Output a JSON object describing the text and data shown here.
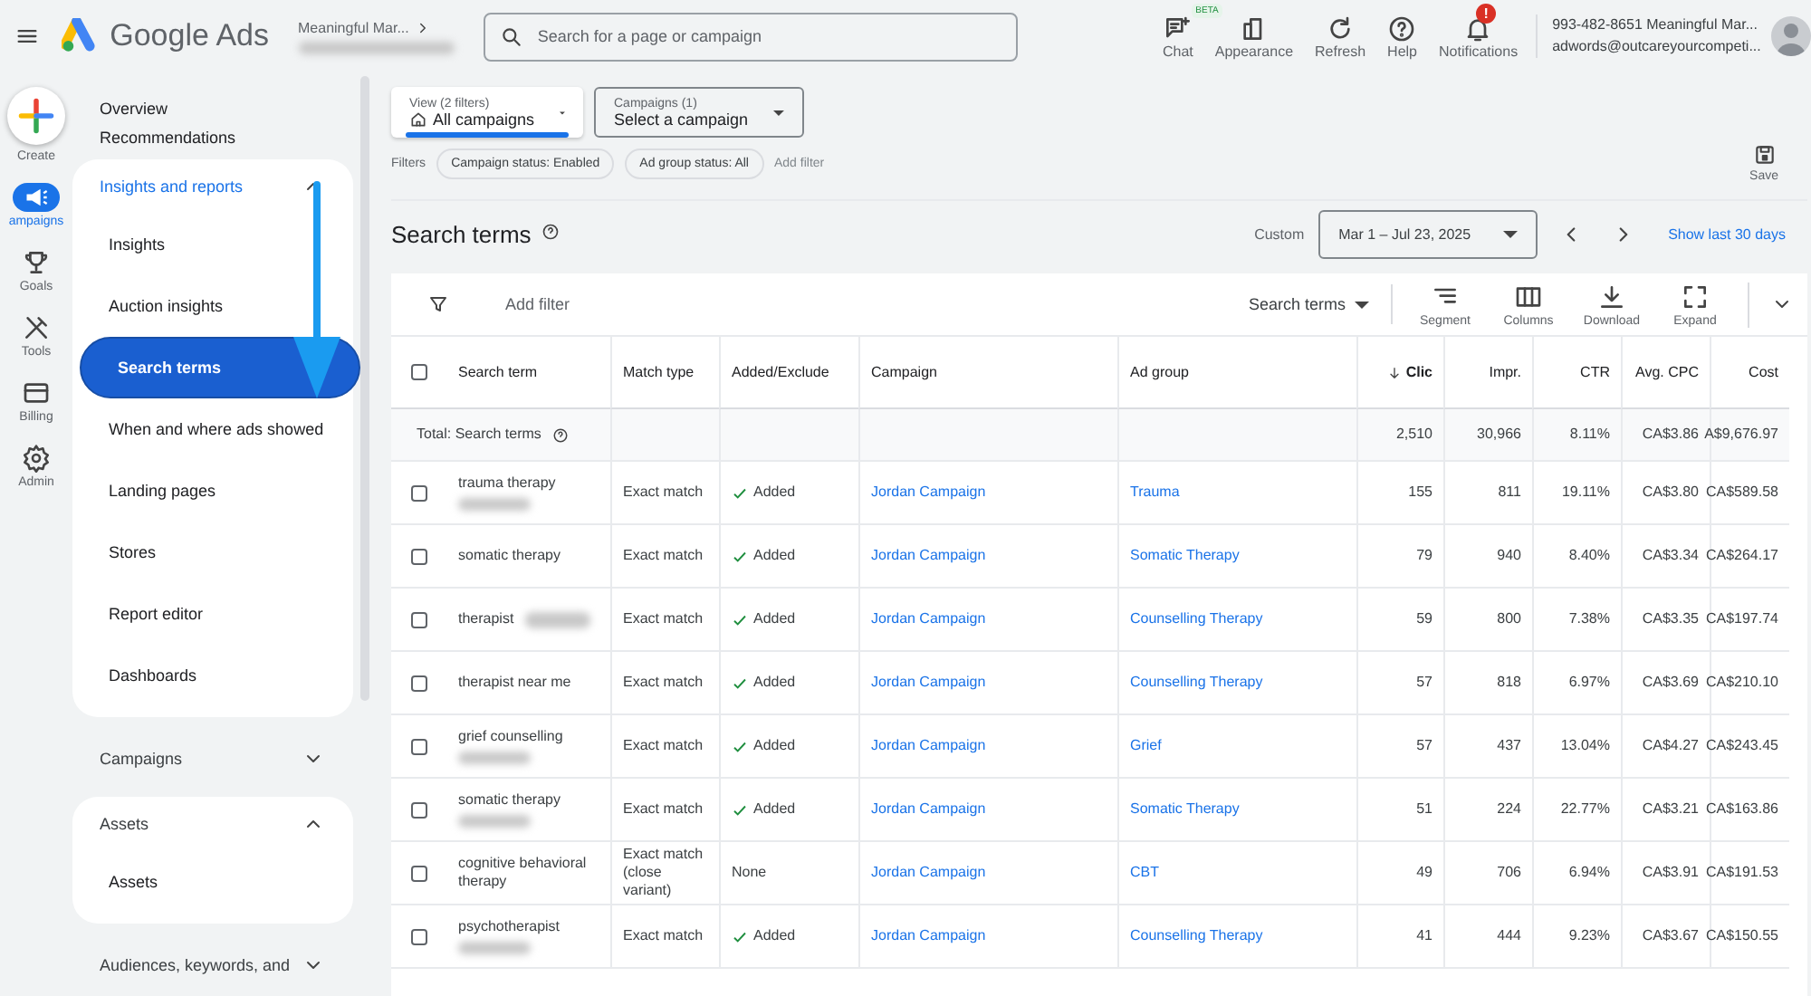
{
  "header": {
    "product": "Google Ads",
    "account": "Meaningful Mar...",
    "search_placeholder": "Search for a page or campaign",
    "actions": [
      {
        "label": "Chat",
        "badge": "BETA"
      },
      {
        "label": "Appearance"
      },
      {
        "label": "Refresh"
      },
      {
        "label": "Help"
      },
      {
        "label": "Notifications",
        "alert": "!"
      }
    ],
    "account_line1": "993-482-8651 Meaningful Mar...",
    "account_line2": "adwords@outcareyourcompeti..."
  },
  "create": {
    "label": "Create"
  },
  "rail": [
    {
      "label": "ampaigns",
      "selected": true
    },
    {
      "label": "Goals",
      "selected": false
    },
    {
      "label": "Tools",
      "selected": false
    },
    {
      "label": "Billing",
      "selected": false
    },
    {
      "label": "Admin",
      "selected": false
    }
  ],
  "nav": {
    "top": [
      {
        "label": "Overview"
      },
      {
        "label": "Recommendations"
      }
    ],
    "sections": [
      {
        "label": "Insights and reports",
        "expanded": true,
        "items": [
          {
            "label": "Insights",
            "selected": false
          },
          {
            "label": "Auction insights",
            "selected": false
          },
          {
            "label": "Search terms",
            "selected": true
          },
          {
            "label": "When and where ads showed",
            "selected": false
          },
          {
            "label": "Landing pages",
            "selected": false
          },
          {
            "label": "Stores",
            "selected": false
          },
          {
            "label": "Report editor",
            "selected": false
          },
          {
            "label": "Dashboards",
            "selected": false
          }
        ]
      },
      {
        "label": "Campaigns",
        "expanded": false
      },
      {
        "label": "Assets",
        "expanded": true,
        "items": [
          {
            "label": "Assets",
            "selected": false
          }
        ]
      },
      {
        "label": "Audiences, keywords, and",
        "expanded": false
      }
    ]
  },
  "filters": {
    "view": {
      "label": "View (2 filters)",
      "value": "All campaigns"
    },
    "campaigns": {
      "label": "Campaigns (1)",
      "value": "Select a campaign"
    },
    "label": "Filters",
    "chips": [
      "Campaign status: Enabled",
      "Ad group status: All"
    ],
    "add_filter": "Add filter",
    "save": "Save"
  },
  "report": {
    "title": "Search terms",
    "date_label": "Custom",
    "date_range": "Mar 1 – Jul 23, 2025",
    "show_last": "Show last 30 days"
  },
  "toolbar": {
    "add_filter": "Add filter",
    "view": "Search terms",
    "tools": [
      "Segment",
      "Columns",
      "Download",
      "Expand"
    ]
  },
  "table": {
    "select_all_checked": false,
    "columns": [
      {
        "label": "Search term",
        "sorted": false
      },
      {
        "label": "Match type",
        "sorted": false
      },
      {
        "label": "Added/Exclude",
        "sorted": false
      },
      {
        "label": "Campaign",
        "sorted": false
      },
      {
        "label": "Ad group",
        "sorted": false
      },
      {
        "label": "Clic",
        "sorted": true
      },
      {
        "label": "Impr.",
        "sorted": false
      },
      {
        "label": "CTR",
        "sorted": false
      },
      {
        "label": "Avg. CPC",
        "sorted": false
      },
      {
        "label": "Cost",
        "sorted": false
      }
    ],
    "total": {
      "label": "Total: Search terms",
      "values": [
        "2,510",
        "30,966",
        "8.11%",
        "CA$3.86",
        "A$9,676.97"
      ]
    },
    "rows": [
      {
        "checked": false,
        "term": "trauma therapy",
        "blur_below": true,
        "match": "Exact match",
        "checkmark": true,
        "added": "Added",
        "campaign": "Jordan Campaign",
        "ad_group": "Trauma",
        "values": [
          "155",
          "811",
          "19.11%",
          "CA$3.80",
          "CA$589.58"
        ]
      },
      {
        "checked": false,
        "term": "somatic therapy",
        "match": "Exact match",
        "checkmark": true,
        "added": "Added",
        "campaign": "Jordan Campaign",
        "ad_group": "Somatic Therapy",
        "values": [
          "79",
          "940",
          "8.40%",
          "CA$3.34",
          "CA$264.17"
        ]
      },
      {
        "checked": false,
        "term": "therapist",
        "blur_inline": true,
        "match": "Exact match",
        "checkmark": true,
        "added": "Added",
        "campaign": "Jordan Campaign",
        "ad_group": "Counselling Therapy",
        "values": [
          "59",
          "800",
          "7.38%",
          "CA$3.35",
          "CA$197.74"
        ]
      },
      {
        "checked": false,
        "term": "therapist near me",
        "match": "Exact match",
        "checkmark": true,
        "added": "Added",
        "campaign": "Jordan Campaign",
        "ad_group": "Counselling Therapy",
        "values": [
          "57",
          "818",
          "6.97%",
          "CA$3.69",
          "CA$210.10"
        ]
      },
      {
        "checked": false,
        "term": "grief counselling",
        "blur_below": true,
        "match": "Exact match",
        "checkmark": true,
        "added": "Added",
        "campaign": "Jordan Campaign",
        "ad_group": "Grief",
        "values": [
          "57",
          "437",
          "13.04%",
          "CA$4.27",
          "CA$243.45"
        ]
      },
      {
        "checked": false,
        "term": "somatic therapy",
        "blur_below": true,
        "match": "Exact match",
        "checkmark": true,
        "added": "Added",
        "campaign": "Jordan Campaign",
        "ad_group": "Somatic Therapy",
        "values": [
          "51",
          "224",
          "22.77%",
          "CA$3.21",
          "CA$163.86"
        ]
      },
      {
        "checked": false,
        "term": "cognitive behavioral therapy",
        "match": "Exact match (close variant)",
        "checkmark": false,
        "added": "None",
        "campaign": "Jordan Campaign",
        "ad_group": "CBT",
        "values": [
          "49",
          "706",
          "6.94%",
          "CA$3.91",
          "CA$191.53"
        ]
      },
      {
        "checked": false,
        "term": "psychotherapist",
        "blur_below": true,
        "match": "Exact match",
        "checkmark": true,
        "added": "Added",
        "campaign": "Jordan Campaign",
        "ad_group": "Counselling Therapy",
        "values": [
          "41",
          "444",
          "9.23%",
          "CA$3.67",
          "CA$150.55"
        ]
      }
    ]
  }
}
